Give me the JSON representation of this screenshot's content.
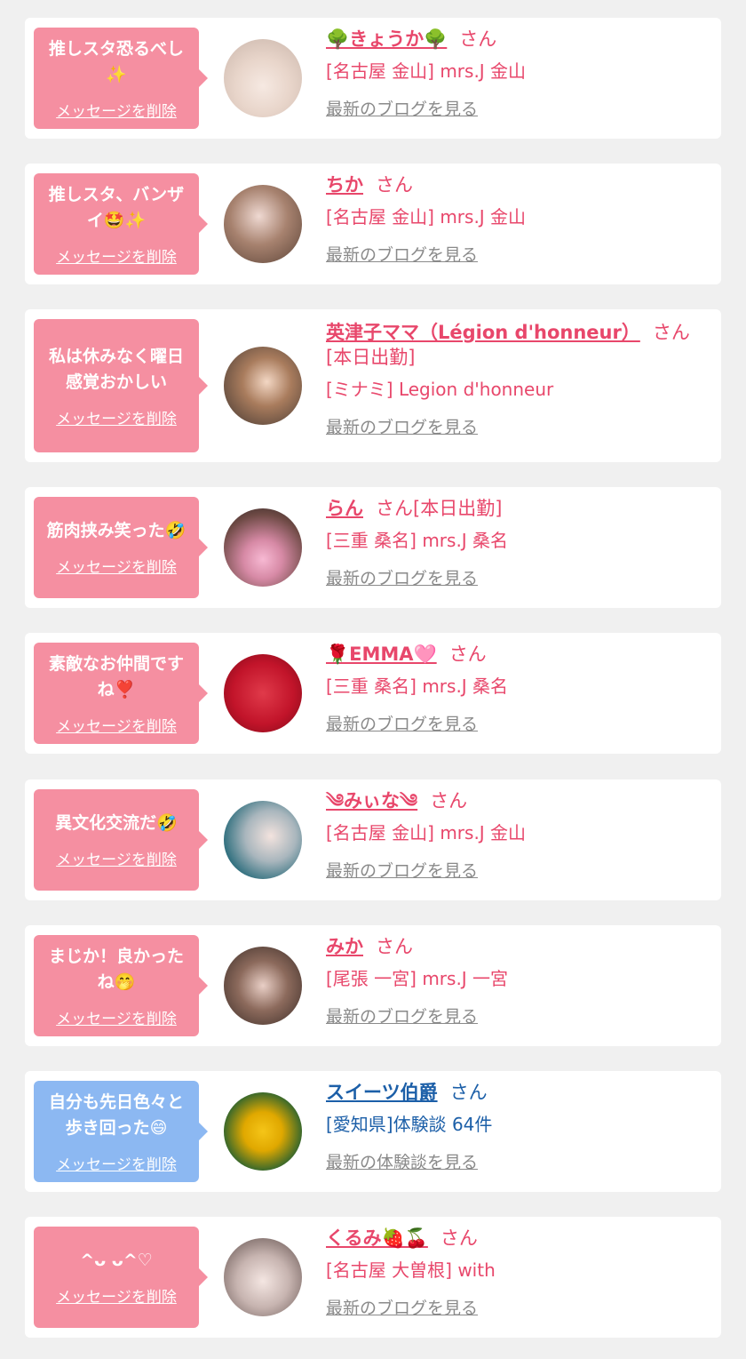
{
  "cards": [
    {
      "message": "推しスタ恐るべし✨",
      "delete_label": "メッセージを削除",
      "name": "🌳きょうか🌳",
      "suffix": "さん",
      "shop": "[名古屋 金山] mrs.J 金山",
      "link": "最新のブログを見る"
    },
    {
      "message": "推しスタ、バンザイ🤩✨",
      "delete_label": "メッセージを削除",
      "name": "ちか",
      "suffix": "さん",
      "shop": "[名古屋 金山] mrs.J 金山",
      "link": "最新のブログを見る"
    },
    {
      "message": "私は休みなく曜日感覚おかしい",
      "delete_label": "メッセージを削除",
      "name": "英津子ママ（Légion d'honneur）",
      "suffix": "さん[本日出勤]",
      "shop": "[ミナミ] Legion d'honneur",
      "link": "最新のブログを見る"
    },
    {
      "message": "筋肉挟み笑った🤣",
      "delete_label": "メッセージを削除",
      "name": "らん",
      "suffix": "さん[本日出勤]",
      "shop": "[三重 桑名] mrs.J 桑名",
      "link": "最新のブログを見る"
    },
    {
      "message": "素敵なお仲間ですね❣️",
      "delete_label": "メッセージを削除",
      "name": "🌹EMMA🩷",
      "suffix": "さん",
      "shop": "[三重 桑名] mrs.J 桑名",
      "link": "最新のブログを見る"
    },
    {
      "message": "異文化交流だ🤣",
      "delete_label": "メッセージを削除",
      "name": "༄みぃな༄",
      "suffix": "さん",
      "shop": "[名古屋 金山] mrs.J 金山",
      "link": "最新のブログを見る"
    },
    {
      "message": "まじか！良かったね🤭",
      "delete_label": "メッセージを削除",
      "name": "みか",
      "suffix": "さん",
      "shop": "[尾張 一宮] mrs.J 一宮",
      "link": "最新のブログを見る"
    },
    {
      "message": "自分も先日色々と歩き回った😄",
      "delete_label": "メッセージを削除",
      "name": "スイーツ伯爵",
      "suffix": "さん",
      "shop": "[愛知県]体験談 64件",
      "link": "最新の体験談を見る"
    },
    {
      "message": "^ᴗ ᴗ^♡",
      "delete_label": "メッセージを削除",
      "name": "くるみ🍓🍒",
      "suffix": "さん",
      "shop": "[名古屋 大曽根] with",
      "link": "最新のブログを見る"
    }
  ],
  "colors": {
    "page_bg": "#f0f0f0",
    "card_bg": "#ffffff",
    "bubble_pink": "#f58fa1",
    "bubble_blue": "#8cb8f2",
    "accent_pink": "#e8476b",
    "accent_blue": "#1c5fa8",
    "link_gray": "#8a8a8a"
  }
}
